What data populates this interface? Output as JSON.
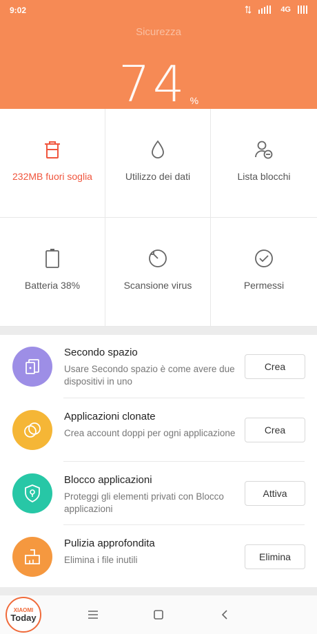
{
  "status_bar": {
    "time": "9:02",
    "network": "4G"
  },
  "header": {
    "title": "Sicurezza",
    "score": "74",
    "score_unit": "%"
  },
  "grid": [
    {
      "label": "232MB fuori soglia",
      "icon": "trash-icon",
      "alert": true
    },
    {
      "label": "Utilizzo dei dati",
      "icon": "drop-icon"
    },
    {
      "label": "Lista blocchi",
      "icon": "user-block-icon"
    },
    {
      "label": "Batteria 38%",
      "icon": "battery-icon"
    },
    {
      "label": "Scansione virus",
      "icon": "scan-icon"
    },
    {
      "label": "Permessi",
      "icon": "check-circle-icon"
    }
  ],
  "features": [
    {
      "title": "Secondo spazio",
      "desc": "Usare Secondo spazio è come avere due dispositivi in uno",
      "button": "Crea",
      "icon": "second-space-icon",
      "color": "#9d8ee6"
    },
    {
      "title": "Applicazioni clonate",
      "desc": "Crea account doppi per ogni applicazione",
      "button": "Crea",
      "icon": "clone-icon",
      "color": "#f5b636"
    },
    {
      "title": "Blocco applicazioni",
      "desc": "Proteggi gli elementi privati con Blocco applicazioni",
      "button": "Attiva",
      "icon": "shield-lock-icon",
      "color": "#27c7a6"
    },
    {
      "title": "Pulizia approfondita",
      "desc": "Elimina i file inutili",
      "button": "Elimina",
      "icon": "broom-icon",
      "color": "#f5983f"
    }
  ],
  "colors": {
    "header": "#f68a55",
    "alert": "#f0553d"
  },
  "watermark": {
    "line1": "XIAOMI",
    "line2": "Today"
  }
}
